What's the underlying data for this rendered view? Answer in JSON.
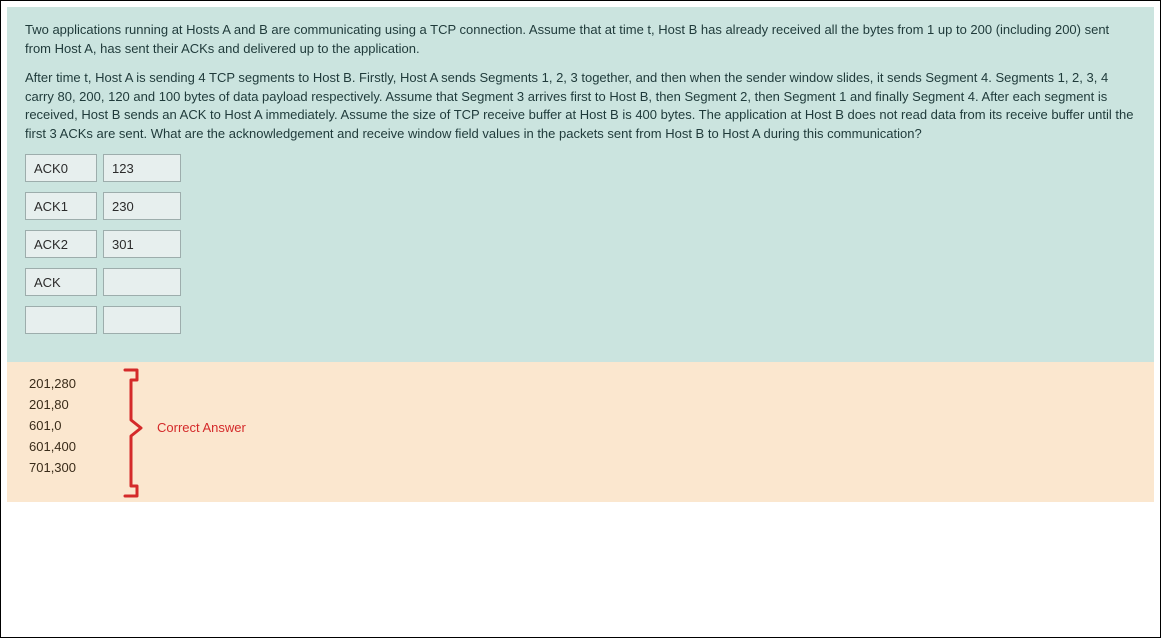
{
  "question": {
    "para1": "Two applications running at Hosts A and B are communicating using a TCP connection. Assume that at time t, Host B has already received all the bytes from 1 up to 200 (including 200) sent from Host A, has sent their ACKs and delivered up to the application.",
    "para2": "After time t, Host A is sending 4 TCP segments to Host B. Firstly, Host A sends Segments 1, 2, 3 together, and then when the sender window slides, it sends Segment 4. Segments 1, 2, 3, 4 carry 80, 200, 120 and 100 bytes of data payload respectively. Assume that Segment 3 arrives first to Host B, then Segment 2, then Segment 1 and finally Segment 4. After each segment is received, Host B sends an ACK to Host A immediately. Assume the size of TCP receive buffer at Host B is 400 bytes. The application at Host B does not read data from its receive buffer until the first 3 ACKs are sent. What are the acknowledgement and receive window field values in the packets sent from Host B to Host A during this communication?"
  },
  "rows": [
    {
      "label": "ACK0",
      "value": "123"
    },
    {
      "label": "ACK1",
      "value": "230"
    },
    {
      "label": "ACK2",
      "value": "301"
    },
    {
      "label": "ACK",
      "value": ""
    },
    {
      "label": "",
      "value": ""
    }
  ],
  "answers": [
    "201,280",
    "201,80",
    "601,0",
    "601,400",
    "701,300"
  ],
  "correct_label": "Correct Answer",
  "colors": {
    "question_bg": "#cbe4df",
    "answer_bg": "#fbe7cf",
    "brace_color": "#d42a2a"
  }
}
